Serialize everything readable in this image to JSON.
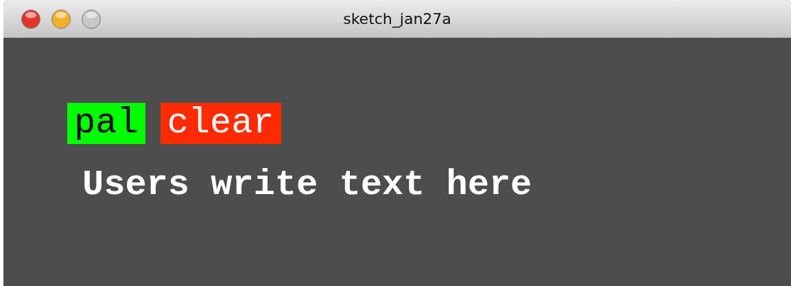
{
  "window": {
    "title": "sketch_jan27a",
    "controls": [
      {
        "kind": "close",
        "disabled": false
      },
      {
        "kind": "minimize",
        "disabled": false
      },
      {
        "kind": "zoom",
        "disabled": true
      }
    ]
  },
  "buttons": [
    {
      "label": "pal",
      "color": "#00ff00"
    },
    {
      "label": "clear",
      "color": "#ff2a00"
    }
  ],
  "canvas_text": "Users write text here"
}
